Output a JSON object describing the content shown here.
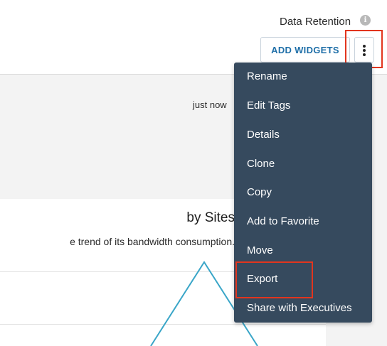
{
  "header": {
    "data_retention_label": "Data Retention",
    "add_widgets_label": "ADD WIDGETS"
  },
  "row": {
    "timestamp": "just now"
  },
  "widget": {
    "title": "by Sites",
    "subtitle": "e trend of its bandwidth consumption."
  },
  "menu": {
    "items": [
      {
        "label": "Rename"
      },
      {
        "label": "Edit Tags"
      },
      {
        "label": "Details"
      },
      {
        "label": "Clone"
      },
      {
        "label": "Copy"
      },
      {
        "label": "Add to Favorite"
      },
      {
        "label": "Move"
      },
      {
        "label": "Export"
      },
      {
        "label": "Share with Executives"
      }
    ]
  },
  "colors": {
    "accent": "#1f6fa8",
    "menu_background": "#364a5e",
    "highlight": "#e2351e",
    "chart_line": "#3aa6c8"
  },
  "icons": {
    "info": "info-icon",
    "more": "vertical-dots-icon"
  }
}
